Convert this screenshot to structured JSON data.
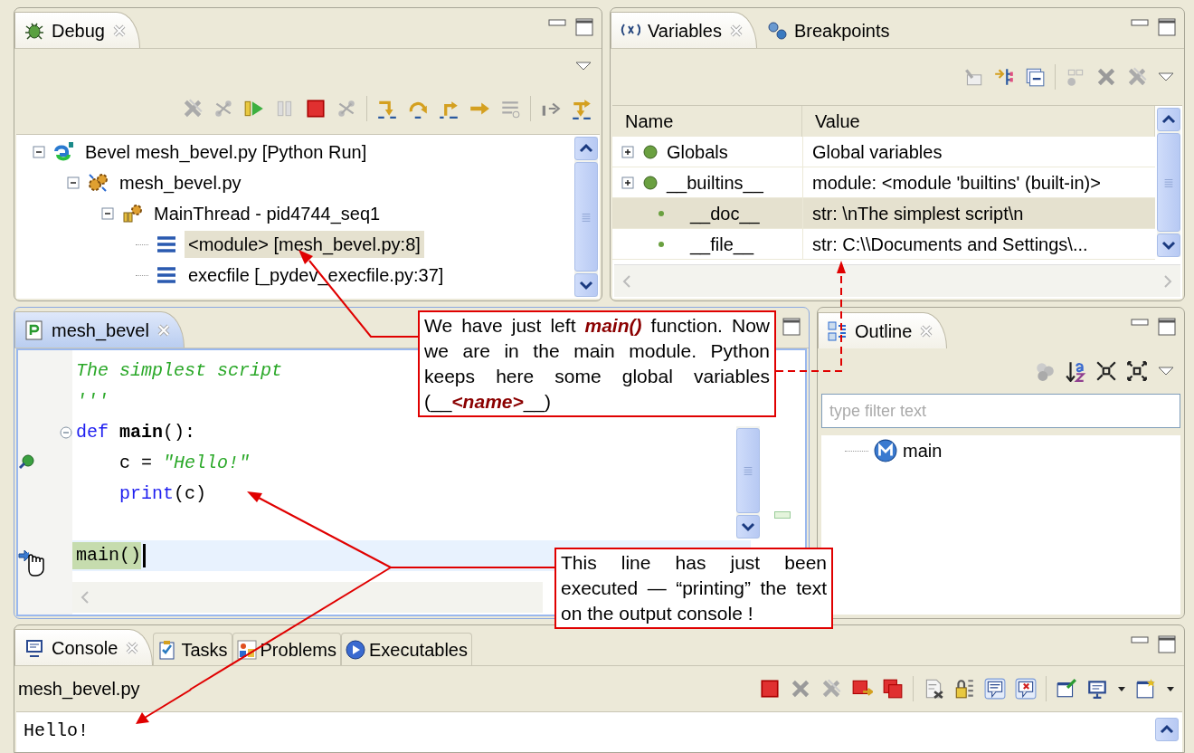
{
  "debug_view": {
    "tab": {
      "label": "Debug"
    },
    "tree": [
      {
        "label": "Bevel mesh_bevel.py [Python Run]",
        "kind": "launch",
        "expanded": true,
        "selected": false,
        "children": [
          {
            "label": "mesh_bevel.py",
            "kind": "process",
            "expanded": true,
            "selected": false,
            "children": [
              {
                "label": "MainThread - pid4744_seq1",
                "kind": "thread",
                "expanded": true,
                "selected": false,
                "children": [
                  {
                    "label": "<module> [mesh_bevel.py:8]",
                    "kind": "frame",
                    "selected": true
                  },
                  {
                    "label": "execfile [_pydev_execfile.py:37]",
                    "kind": "frame",
                    "selected": false
                  }
                ]
              }
            ]
          }
        ]
      }
    ]
  },
  "variables_view": {
    "tabs": [
      {
        "label": "Variables",
        "selected": true
      },
      {
        "label": "Breakpoints",
        "selected": false
      }
    ],
    "columns": [
      "Name",
      "Value"
    ],
    "rows": [
      {
        "name": "Globals",
        "value": "Global variables",
        "expandable": true,
        "selected": false
      },
      {
        "name": "__builtins__",
        "value": "module: <module 'builtins' (built-in)>",
        "expandable": true,
        "selected": false
      },
      {
        "name": "__doc__",
        "value": "str: \\nThe simplest script\\n",
        "expandable": false,
        "selected": true
      },
      {
        "name": "__file__",
        "value": "str: C:\\\\Documents and Settings\\...",
        "expandable": false,
        "selected": false
      }
    ]
  },
  "editor": {
    "tab": {
      "label": "mesh_bevel"
    },
    "lines": [
      {
        "foldable": false,
        "breakpoint": false,
        "current": false,
        "segments": [
          {
            "kind": "comment",
            "text": "The simplest script"
          }
        ]
      },
      {
        "foldable": false,
        "breakpoint": false,
        "current": false,
        "segments": [
          {
            "kind": "comment",
            "text": "'''"
          }
        ]
      },
      {
        "foldable": true,
        "breakpoint": false,
        "current": false,
        "segments": [
          {
            "kind": "keyword",
            "text": "def "
          },
          {
            "kind": "name",
            "text": "main"
          },
          {
            "kind": "plain",
            "text": "():"
          }
        ]
      },
      {
        "foldable": false,
        "breakpoint": true,
        "current": false,
        "segments": [
          {
            "kind": "plain",
            "text": "    c = "
          },
          {
            "kind": "string",
            "text": "\"Hello!\""
          }
        ]
      },
      {
        "foldable": false,
        "breakpoint": false,
        "current": false,
        "segments": [
          {
            "kind": "keyword",
            "text": "    print"
          },
          {
            "kind": "plain",
            "text": "(c)"
          }
        ]
      },
      {
        "foldable": false,
        "breakpoint": false,
        "current": false
      },
      {
        "foldable": false,
        "breakpoint": false,
        "current": true,
        "segments": [
          {
            "kind": "plain",
            "text": "main()"
          }
        ]
      }
    ]
  },
  "outline_view": {
    "tab": {
      "label": "Outline"
    },
    "filter": {
      "placeholder": "type filter text"
    },
    "items": [
      {
        "label": "main",
        "kind": "method"
      }
    ]
  },
  "console_view": {
    "tabs": [
      {
        "label": "Console",
        "selected": true
      },
      {
        "label": "Tasks",
        "selected": false
      },
      {
        "label": "Problems",
        "selected": false
      },
      {
        "label": "Executables",
        "selected": false
      }
    ],
    "process": "mesh_bevel.py",
    "output": [
      "Hello!"
    ]
  },
  "callouts": [
    {
      "text": "We have just left **main()** function. Now we are in the main module. Python keeps here some global variables (__**<name>**__)"
    },
    {
      "text": "This line has just been executed — “printing” the text on the output console !"
    }
  ]
}
